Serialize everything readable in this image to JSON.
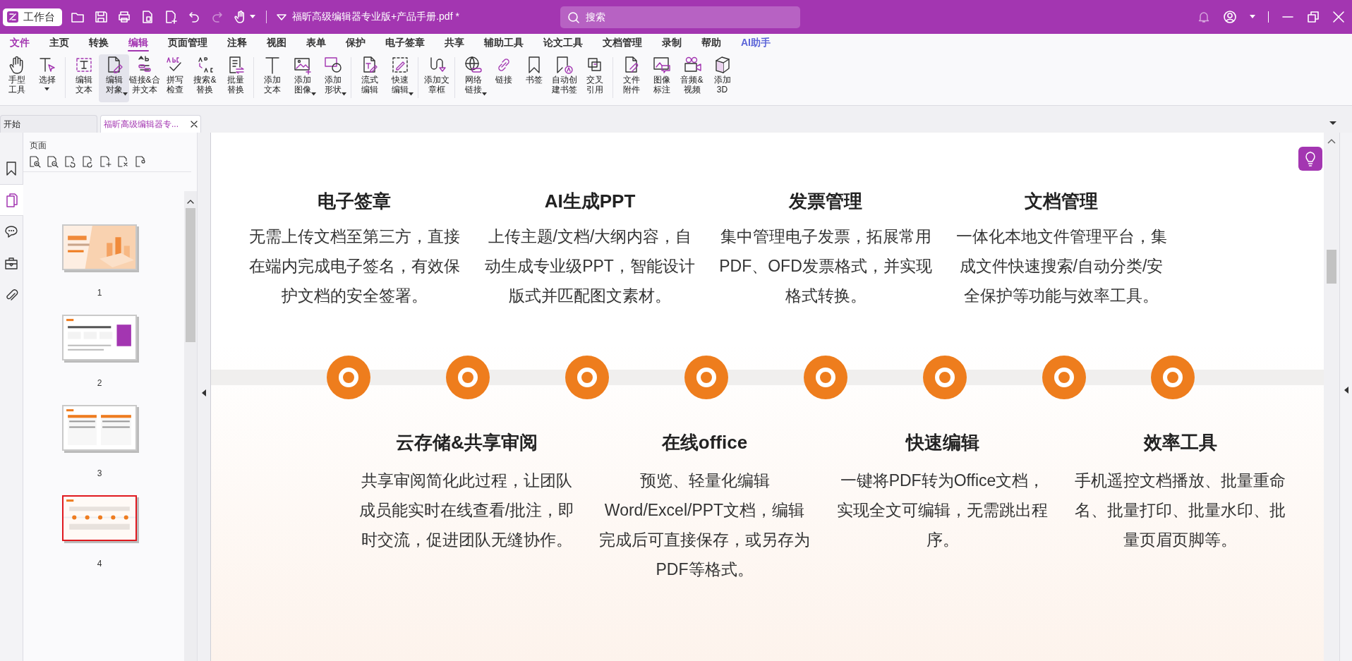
{
  "title_bar": {
    "app_button": "工作台",
    "quick_access": [
      {
        "disabled": false
      },
      {
        "disabled": false
      },
      {
        "disabled": false
      },
      {
        "disabled": false
      },
      {
        "disabled": false
      },
      {
        "disabled": false
      },
      {
        "disabled": true
      },
      {
        "disabled": false
      }
    ],
    "document_title": "福昕高级编辑器专业版+产品手册.pdf *",
    "search": {
      "placeholder": "搜索"
    }
  },
  "menu": [
    {
      "label": "文件",
      "kind": "file",
      "selected": false
    },
    {
      "label": "主页",
      "kind": "normal",
      "selected": false
    },
    {
      "label": "转换",
      "kind": "normal",
      "selected": false
    },
    {
      "label": "编辑",
      "kind": "normal",
      "selected": true
    },
    {
      "label": "页面管理",
      "kind": "normal",
      "selected": false
    },
    {
      "label": "注释",
      "kind": "normal",
      "selected": false
    },
    {
      "label": "视图",
      "kind": "normal",
      "selected": false
    },
    {
      "label": "表单",
      "kind": "normal",
      "selected": false
    },
    {
      "label": "保护",
      "kind": "normal",
      "selected": false
    },
    {
      "label": "电子签章",
      "kind": "normal",
      "selected": false
    },
    {
      "label": "共享",
      "kind": "normal",
      "selected": false
    },
    {
      "label": "辅助工具",
      "kind": "normal",
      "selected": false
    },
    {
      "label": "论文工具",
      "kind": "normal",
      "selected": false
    },
    {
      "label": "文档管理",
      "kind": "normal",
      "selected": false
    },
    {
      "label": "录制",
      "kind": "normal",
      "selected": false
    },
    {
      "label": "帮助",
      "kind": "normal",
      "selected": false
    },
    {
      "label": "AI助手",
      "kind": "ai",
      "selected": false
    }
  ],
  "ribbon": [
    {
      "items": [
        {
          "label": "手型工具",
          "dropdown": false,
          "selected": false
        },
        {
          "label": "选择",
          "dropdown": true,
          "selected": false
        }
      ]
    },
    {
      "items": [
        {
          "label": "编辑文本",
          "dropdown": false,
          "selected": false
        },
        {
          "label": "编辑对象",
          "dropdown": true,
          "selected": true
        },
        {
          "label": "链接&合并文本",
          "dropdown": false,
          "selected": false
        },
        {
          "label": "拼写检查",
          "dropdown": false,
          "selected": false
        },
        {
          "label": "搜索&替换",
          "dropdown": false,
          "selected": false
        },
        {
          "label": "批量替换",
          "dropdown": false,
          "selected": false
        }
      ]
    },
    {
      "items": [
        {
          "label": "添加文本",
          "dropdown": false,
          "selected": false
        },
        {
          "label": "添加图像",
          "dropdown": true,
          "selected": false
        },
        {
          "label": "添加形状",
          "dropdown": true,
          "selected": false
        }
      ]
    },
    {
      "items": [
        {
          "label": "流式编辑",
          "dropdown": false,
          "selected": false
        },
        {
          "label": "快速编辑",
          "dropdown": true,
          "selected": false
        }
      ]
    },
    {
      "items": [
        {
          "label": "添加文章框",
          "dropdown": false,
          "selected": false
        }
      ]
    },
    {
      "items": [
        {
          "label": "网络链接",
          "dropdown": true,
          "selected": false
        },
        {
          "label": "链接",
          "dropdown": false,
          "selected": false
        },
        {
          "label": "书签",
          "dropdown": false,
          "selected": false
        },
        {
          "label": "自动创建书签",
          "dropdown": false,
          "selected": false
        },
        {
          "label": "交叉引用",
          "dropdown": false,
          "selected": false
        }
      ]
    },
    {
      "items": [
        {
          "label": "文件附件",
          "dropdown": false,
          "selected": false
        },
        {
          "label": "图像标注",
          "dropdown": false,
          "selected": false
        },
        {
          "label": "音频& 视频",
          "dropdown": false,
          "selected": false
        },
        {
          "label": "添加3D",
          "dropdown": false,
          "selected": false
        }
      ]
    }
  ],
  "doc_tabs": [
    {
      "label": "开始",
      "selected": false,
      "closable": false
    },
    {
      "label": "福昕高级编辑器专...",
      "selected": true,
      "closable": true
    }
  ],
  "side_nav": [
    {
      "selected": false
    },
    {
      "selected": true
    },
    {
      "selected": false
    },
    {
      "selected": false
    },
    {
      "selected": false
    }
  ],
  "pages_panel": {
    "title": "页面",
    "thumbnails": [
      {
        "label": "1",
        "selected": false
      },
      {
        "label": "2",
        "selected": false
      },
      {
        "label": "3",
        "selected": false
      },
      {
        "label": "4",
        "selected": true
      }
    ]
  },
  "document": {
    "top_features": [
      {
        "title": "电子签章",
        "text": "无需上传文档至第三方，直接在端内完成电子签名，有效保护文档的安全签署。"
      },
      {
        "title": "AI生成PPT",
        "text": "上传主题/文档/大纲内容，自动生成专业级PPT，智能设计版式并匹配图文素材。"
      },
      {
        "title": "发票管理",
        "text": "集中管理电子发票，拓展常用PDF、OFD发票格式，并实现格式转换。"
      },
      {
        "title": "文档管理",
        "text": "一体化本地文件管理平台，集成文件快速搜索/自动分类/安全保护等功能与效率工具。"
      }
    ],
    "bottom_features": [
      {
        "title": "云存储&共享审阅",
        "text": "共享审阅简化此过程，让团队成员能实时在线查看/批注，即时交流，促进团队无缝协作。"
      },
      {
        "title": "在线office",
        "text": "预览、轻量化编辑Word/Excel/PPT文档，编辑完成后可直接保存，或另存为PDF等格式。"
      },
      {
        "title": "快速编辑",
        "text": "一键将PDF转为Office文档，实现全文可编辑，无需跳出程序。"
      },
      {
        "title": "效率工具",
        "text": "手机遥控文档播放、批量重命名、批量打印、批量水印、批量页眉页脚等。"
      }
    ]
  }
}
